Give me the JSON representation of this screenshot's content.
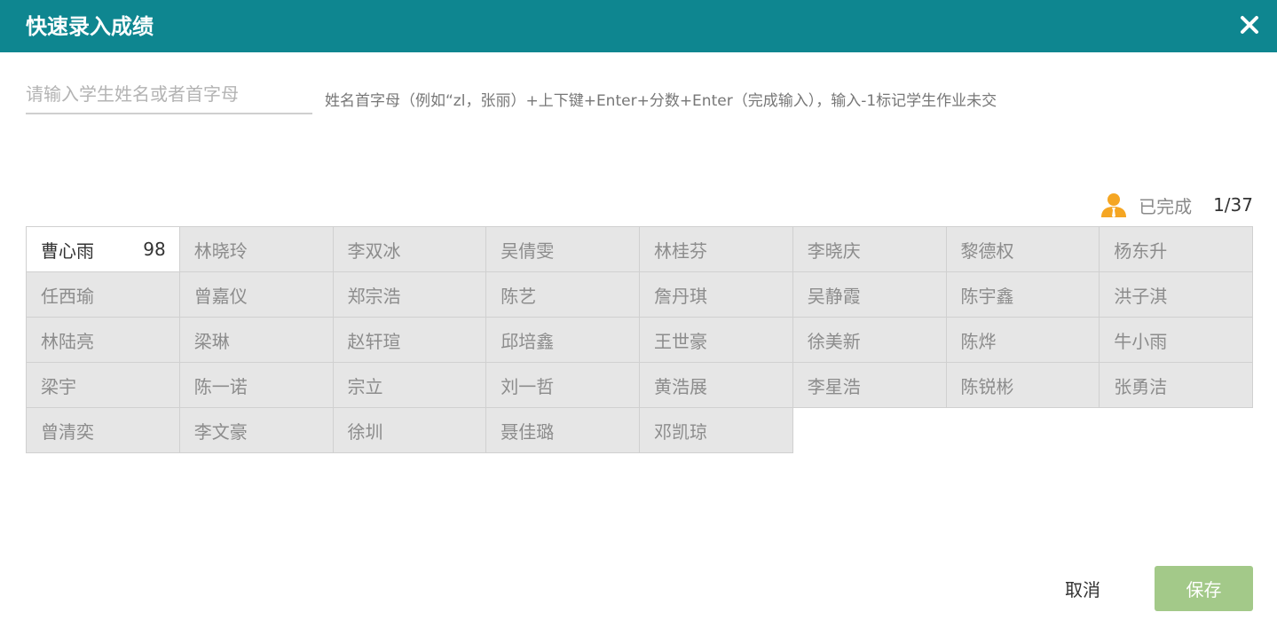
{
  "dialog": {
    "title": "快速录入成绩"
  },
  "search": {
    "placeholder": "请输入学生姓名或者首字母",
    "value": "",
    "hint": "姓名首字母（例如“zl，张丽）+上下键+Enter+分数+Enter（完成输入），输入-1标记学生作业未交"
  },
  "progress": {
    "label": "已完成",
    "count": "1/37"
  },
  "students": [
    {
      "name": "曹心雨",
      "score": "98"
    },
    {
      "name": "林晓玲",
      "score": ""
    },
    {
      "name": "李双冰",
      "score": ""
    },
    {
      "name": "吴倩雯",
      "score": ""
    },
    {
      "name": "林桂芬",
      "score": ""
    },
    {
      "name": "李晓庆",
      "score": ""
    },
    {
      "name": "黎德权",
      "score": ""
    },
    {
      "name": "杨东升",
      "score": ""
    },
    {
      "name": "任西瑜",
      "score": ""
    },
    {
      "name": "曾嘉仪",
      "score": ""
    },
    {
      "name": "郑宗浩",
      "score": ""
    },
    {
      "name": "陈艺",
      "score": ""
    },
    {
      "name": "詹丹琪",
      "score": ""
    },
    {
      "name": "吴静霞",
      "score": ""
    },
    {
      "name": "陈宇鑫",
      "score": ""
    },
    {
      "name": "洪子淇",
      "score": ""
    },
    {
      "name": "林陆亮",
      "score": ""
    },
    {
      "name": "梁琳",
      "score": ""
    },
    {
      "name": "赵轩瑄",
      "score": ""
    },
    {
      "name": "邱培鑫",
      "score": ""
    },
    {
      "name": "王世豪",
      "score": ""
    },
    {
      "name": "徐美新",
      "score": ""
    },
    {
      "name": "陈烨",
      "score": ""
    },
    {
      "name": "牛小雨",
      "score": ""
    },
    {
      "name": "梁宇",
      "score": ""
    },
    {
      "name": "陈一诺",
      "score": ""
    },
    {
      "name": "宗立",
      "score": ""
    },
    {
      "name": "刘一哲",
      "score": ""
    },
    {
      "name": "黄浩展",
      "score": ""
    },
    {
      "name": "李星浩",
      "score": ""
    },
    {
      "name": "陈锐彬",
      "score": ""
    },
    {
      "name": "张勇洁",
      "score": ""
    },
    {
      "name": "曾清奕",
      "score": ""
    },
    {
      "name": "李文豪",
      "score": ""
    },
    {
      "name": "徐圳",
      "score": ""
    },
    {
      "name": "聂佳璐",
      "score": ""
    },
    {
      "name": "邓凯琼",
      "score": ""
    }
  ],
  "footer": {
    "cancel_label": "取消",
    "save_label": "保存"
  },
  "colors": {
    "header": "#0e8690",
    "save_button": "#a3c989",
    "cell_bg": "#e6e6e6",
    "active_cell_bg": "#ffffff",
    "progress_icon": "#f5a623"
  },
  "icons": {
    "close": "close-icon",
    "progress": "teacher-avatar-icon"
  }
}
